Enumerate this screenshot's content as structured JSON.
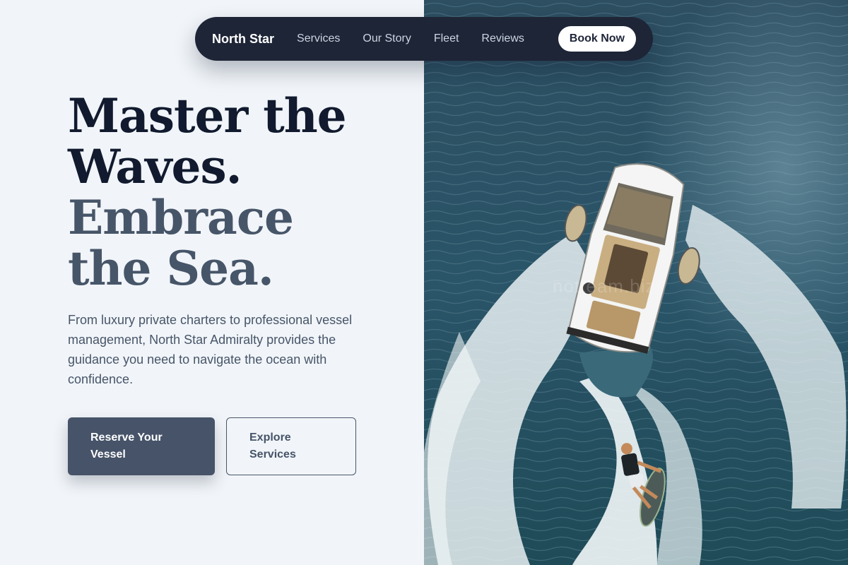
{
  "nav": {
    "brand": "North Star",
    "links": [
      "Services",
      "Our Story",
      "Fleet",
      "Reviews"
    ],
    "cta": "Book Now"
  },
  "hero": {
    "headline_lines": [
      "Master the",
      "Waves.",
      "Embrace",
      "the Sea."
    ],
    "description": "From luxury private charters to professional vessel management, North Star Admiralty provides the guidance you need to navigate the ocean with confidence.",
    "primary_button": "Reserve Your Vessel",
    "secondary_button": "Explore Services",
    "image_watermark": "notteam.biz"
  },
  "colors": {
    "page_bg": "#f1f5f9",
    "nav_bg": "#1e2537",
    "headline_dark": "#111a2e",
    "headline_muted": "#475569",
    "primary_button_bg": "#465368",
    "water": "#2b5468"
  }
}
